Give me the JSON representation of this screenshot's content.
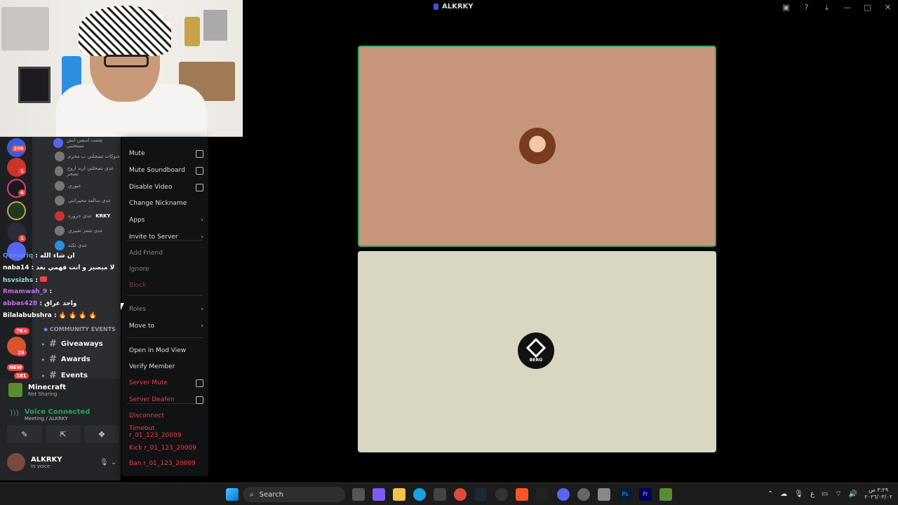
{
  "window": {
    "title": "ALKRKY"
  },
  "context_menu": {
    "items": [
      {
        "label": "Mute",
        "kind": "checkbox",
        "style": "normal"
      },
      {
        "label": "Mute Soundboard",
        "kind": "checkbox",
        "style": "normal"
      },
      {
        "label": "Disable Video",
        "kind": "checkbox",
        "style": "normal"
      },
      {
        "label": "Change Nickname",
        "kind": "plain",
        "style": "normal"
      },
      {
        "label": "Apps",
        "kind": "submenu",
        "style": "normal"
      },
      {
        "label": "Invite to Server",
        "kind": "submenu",
        "style": "normal"
      },
      {
        "label": "Add Friend",
        "kind": "plain",
        "style": "dim"
      },
      {
        "label": "Ignore",
        "kind": "plain",
        "style": "dim"
      },
      {
        "label": "Block",
        "kind": "plain",
        "style": "dimdanger"
      },
      {
        "label": "Roles",
        "kind": "submenu",
        "style": "dim"
      },
      {
        "label": "Move to",
        "kind": "submenu",
        "style": "normal"
      },
      {
        "label": "Open in Mod View",
        "kind": "plain",
        "style": "normal"
      },
      {
        "label": "Verify Member",
        "kind": "plain",
        "style": "normal"
      },
      {
        "label": "Server Mute",
        "kind": "checkbox",
        "style": "danger"
      },
      {
        "label": "Server Deafen",
        "kind": "checkbox",
        "style": "danger"
      },
      {
        "label": "Disconnect",
        "kind": "plain",
        "style": "danger"
      },
      {
        "label": "Timeout r_01_123_20009",
        "kind": "plain",
        "style": "danger"
      },
      {
        "label": "Kick r_01_123_20009",
        "kind": "plain",
        "style": "danger"
      },
      {
        "label": "Ban r_01_123_20009",
        "kind": "plain",
        "style": "danger"
      }
    ]
  },
  "server_badges": [
    "206",
    "1",
    "4",
    "1",
    "7K+",
    "26",
    "NEW",
    "181"
  ],
  "voice_members": [
    "شفت اسمي ايش مسحتني",
    "شوكات تصحلني ب محرم",
    "عدي تصحلني اريد اروح تسحر",
    "عبوري",
    "عدي سالفة مجيرانني",
    "عدي حزورة",
    "عدي شعر تعبيري",
    "عدي نكته"
  ],
  "voice_member_tag": "KRKY",
  "chat_overlay": [
    {
      "user": "Qamariq",
      "text": "ان شاء الله",
      "color": "#5b8def"
    },
    {
      "user": "naba14",
      "text": "لا ميصير و انت فهمي بعد",
      "color": "#ffffff"
    },
    {
      "user": "hsvsizhs",
      "text": "",
      "color": "#ffffff"
    },
    {
      "user": "Rmamwah_9",
      "text": "",
      "color": "#c46cf0"
    },
    {
      "user": "abbas428",
      "text": "واحد عراق",
      "color": "#c46cf0"
    },
    {
      "user": "Bilalabubshra",
      "text": "🔥 🔥 🔥 🔥",
      "color": "#ffffff"
    }
  ],
  "category": "COMMUNITY EVENTS",
  "channels": [
    "Giveaways",
    "Awards",
    "Events"
  ],
  "activity": {
    "name": "Minecraft",
    "status": "Not Sharing"
  },
  "voice_status": {
    "title": "Voice Connected",
    "location": "Meeting / ALKRKY"
  },
  "user": {
    "name": "ALKRKY",
    "status": "In voice"
  },
  "tiles": [
    {
      "avatar": "user-avatar"
    },
    {
      "avatar_label": "BERO"
    }
  ],
  "taskbar": {
    "search": "Search",
    "clock_time": "٣:٢٩ ص",
    "clock_date": "٢٠٢٦/٠٣/٠٢",
    "lang": "ع"
  },
  "colors": {
    "speaking": "#3ba55c",
    "danger": "#f23f43",
    "tile1": "#c7957b",
    "tile2": "#d9d6c2"
  }
}
